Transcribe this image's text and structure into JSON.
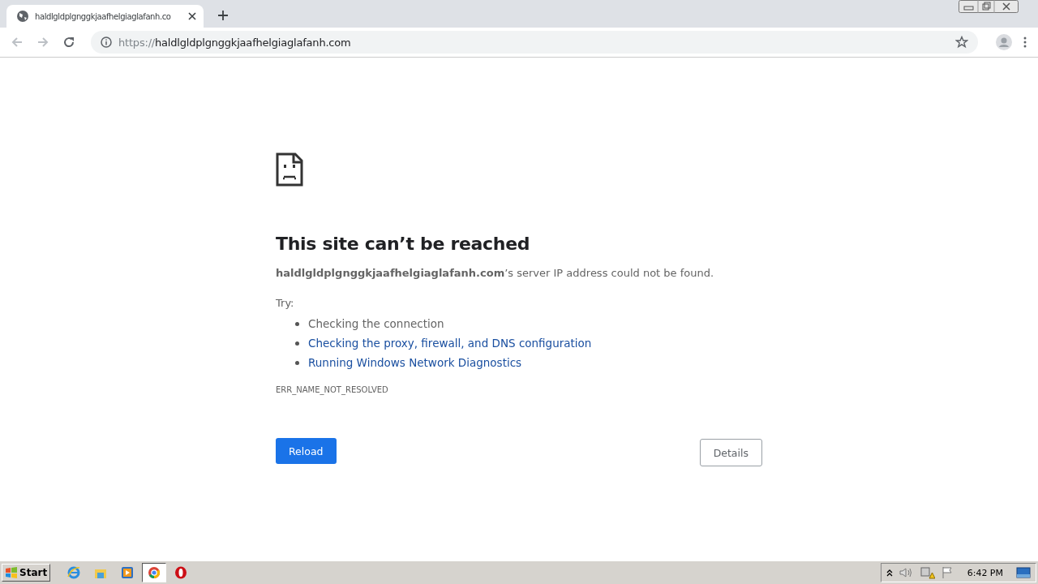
{
  "tab": {
    "title": "haldlgldplgnggkjaafhelgiaglafanh.co"
  },
  "address_bar": {
    "scheme": "https://",
    "host": "haldlgldplgnggkjaafhelgiaglafanh.com"
  },
  "error": {
    "title": "This site can’t be reached",
    "message": "**haldlgldplgnggkjaafhelgiaglafanh.com**’s server IP address could not be found.",
    "try_label": "Try:",
    "suggestions": [
      {
        "kind": "text",
        "text": "Checking the connection"
      },
      {
        "kind": "link",
        "text": "Checking the proxy, firewall, and DNS configuration"
      },
      {
        "kind": "link",
        "text": "Running Windows Network Diagnostics"
      }
    ],
    "code": "ERR_NAME_NOT_RESOLVED"
  },
  "buttons": {
    "reload": "Reload",
    "details": "Details"
  },
  "taskbar": {
    "start": "Start",
    "apps": [
      {
        "kind": "ie",
        "selected": false
      },
      {
        "kind": "folder",
        "selected": false
      },
      {
        "kind": "media",
        "selected": false
      },
      {
        "kind": "chrome",
        "selected": true
      },
      {
        "kind": "opera",
        "selected": false
      }
    ],
    "clock": "6:42 PM"
  }
}
